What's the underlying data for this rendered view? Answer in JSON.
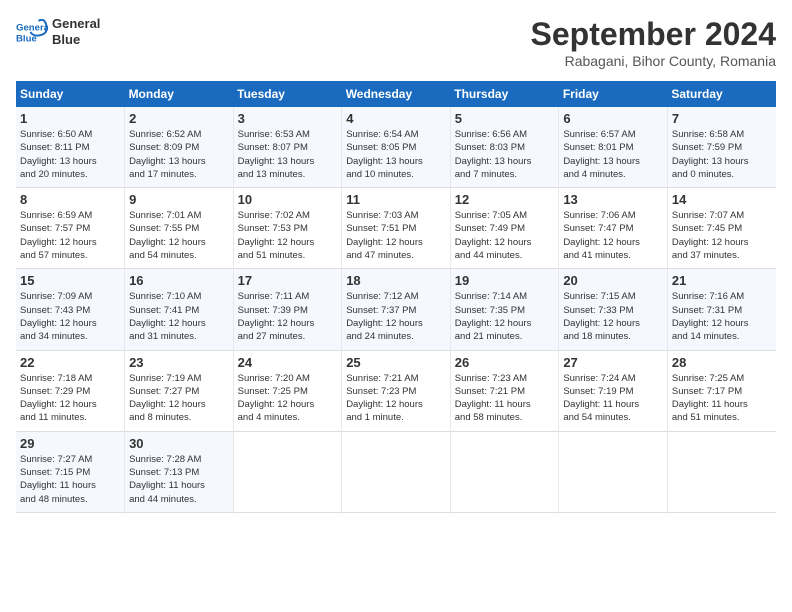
{
  "header": {
    "logo_line1": "General",
    "logo_line2": "Blue",
    "month_title": "September 2024",
    "location": "Rabagani, Bihor County, Romania"
  },
  "weekdays": [
    "Sunday",
    "Monday",
    "Tuesday",
    "Wednesday",
    "Thursday",
    "Friday",
    "Saturday"
  ],
  "weeks": [
    [
      {
        "day": "1",
        "sunrise": "6:50 AM",
        "sunset": "8:11 PM",
        "daylight": "13 hours and 20 minutes."
      },
      {
        "day": "2",
        "sunrise": "6:52 AM",
        "sunset": "8:09 PM",
        "daylight": "13 hours and 17 minutes."
      },
      {
        "day": "3",
        "sunrise": "6:53 AM",
        "sunset": "8:07 PM",
        "daylight": "13 hours and 13 minutes."
      },
      {
        "day": "4",
        "sunrise": "6:54 AM",
        "sunset": "8:05 PM",
        "daylight": "13 hours and 10 minutes."
      },
      {
        "day": "5",
        "sunrise": "6:56 AM",
        "sunset": "8:03 PM",
        "daylight": "13 hours and 7 minutes."
      },
      {
        "day": "6",
        "sunrise": "6:57 AM",
        "sunset": "8:01 PM",
        "daylight": "13 hours and 4 minutes."
      },
      {
        "day": "7",
        "sunrise": "6:58 AM",
        "sunset": "7:59 PM",
        "daylight": "13 hours and 0 minutes."
      }
    ],
    [
      {
        "day": "8",
        "sunrise": "6:59 AM",
        "sunset": "7:57 PM",
        "daylight": "12 hours and 57 minutes."
      },
      {
        "day": "9",
        "sunrise": "7:01 AM",
        "sunset": "7:55 PM",
        "daylight": "12 hours and 54 minutes."
      },
      {
        "day": "10",
        "sunrise": "7:02 AM",
        "sunset": "7:53 PM",
        "daylight": "12 hours and 51 minutes."
      },
      {
        "day": "11",
        "sunrise": "7:03 AM",
        "sunset": "7:51 PM",
        "daylight": "12 hours and 47 minutes."
      },
      {
        "day": "12",
        "sunrise": "7:05 AM",
        "sunset": "7:49 PM",
        "daylight": "12 hours and 44 minutes."
      },
      {
        "day": "13",
        "sunrise": "7:06 AM",
        "sunset": "7:47 PM",
        "daylight": "12 hours and 41 minutes."
      },
      {
        "day": "14",
        "sunrise": "7:07 AM",
        "sunset": "7:45 PM",
        "daylight": "12 hours and 37 minutes."
      }
    ],
    [
      {
        "day": "15",
        "sunrise": "7:09 AM",
        "sunset": "7:43 PM",
        "daylight": "12 hours and 34 minutes."
      },
      {
        "day": "16",
        "sunrise": "7:10 AM",
        "sunset": "7:41 PM",
        "daylight": "12 hours and 31 minutes."
      },
      {
        "day": "17",
        "sunrise": "7:11 AM",
        "sunset": "7:39 PM",
        "daylight": "12 hours and 27 minutes."
      },
      {
        "day": "18",
        "sunrise": "7:12 AM",
        "sunset": "7:37 PM",
        "daylight": "12 hours and 24 minutes."
      },
      {
        "day": "19",
        "sunrise": "7:14 AM",
        "sunset": "7:35 PM",
        "daylight": "12 hours and 21 minutes."
      },
      {
        "day": "20",
        "sunrise": "7:15 AM",
        "sunset": "7:33 PM",
        "daylight": "12 hours and 18 minutes."
      },
      {
        "day": "21",
        "sunrise": "7:16 AM",
        "sunset": "7:31 PM",
        "daylight": "12 hours and 14 minutes."
      }
    ],
    [
      {
        "day": "22",
        "sunrise": "7:18 AM",
        "sunset": "7:29 PM",
        "daylight": "12 hours and 11 minutes."
      },
      {
        "day": "23",
        "sunrise": "7:19 AM",
        "sunset": "7:27 PM",
        "daylight": "12 hours and 8 minutes."
      },
      {
        "day": "24",
        "sunrise": "7:20 AM",
        "sunset": "7:25 PM",
        "daylight": "12 hours and 4 minutes."
      },
      {
        "day": "25",
        "sunrise": "7:21 AM",
        "sunset": "7:23 PM",
        "daylight": "12 hours and 1 minute."
      },
      {
        "day": "26",
        "sunrise": "7:23 AM",
        "sunset": "7:21 PM",
        "daylight": "11 hours and 58 minutes."
      },
      {
        "day": "27",
        "sunrise": "7:24 AM",
        "sunset": "7:19 PM",
        "daylight": "11 hours and 54 minutes."
      },
      {
        "day": "28",
        "sunrise": "7:25 AM",
        "sunset": "7:17 PM",
        "daylight": "11 hours and 51 minutes."
      }
    ],
    [
      {
        "day": "29",
        "sunrise": "7:27 AM",
        "sunset": "7:15 PM",
        "daylight": "11 hours and 48 minutes."
      },
      {
        "day": "30",
        "sunrise": "7:28 AM",
        "sunset": "7:13 PM",
        "daylight": "11 hours and 44 minutes."
      },
      null,
      null,
      null,
      null,
      null
    ]
  ]
}
